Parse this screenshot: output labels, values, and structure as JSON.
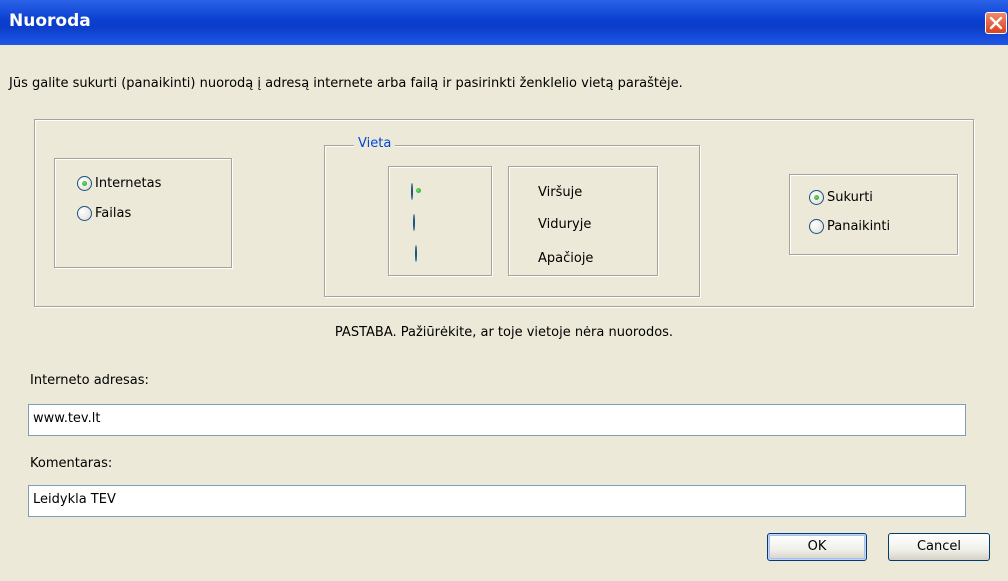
{
  "window": {
    "title": "Nuoroda"
  },
  "info_text": "Jūs galite sukurti (panaikinti)  nuorodą į adresą internete arba failą ir pasirinkti ženklelio vietą paraštėje.",
  "source_group": {
    "options": [
      {
        "label": "Internetas",
        "selected": true
      },
      {
        "label": "Failas",
        "selected": false
      }
    ]
  },
  "location_group": {
    "legend": "Vieta",
    "options": [
      {
        "label": "Viršuje",
        "selected": true
      },
      {
        "label": "Viduryje",
        "selected": false
      },
      {
        "label": "Apačioje",
        "selected": false
      }
    ]
  },
  "action_group": {
    "options": [
      {
        "label": "Sukurti",
        "selected": true
      },
      {
        "label": "Panaikinti",
        "selected": false
      }
    ]
  },
  "note": "PASTABA. Pažiūrėkite, ar toje vietoje nėra nuorodos.",
  "address": {
    "label": "Interneto adresas:",
    "value": "www.tev.lt"
  },
  "comment": {
    "label": "Komentaras:",
    "value": "Leidykla TEV"
  },
  "buttons": {
    "ok": "OK",
    "cancel": "Cancel"
  }
}
